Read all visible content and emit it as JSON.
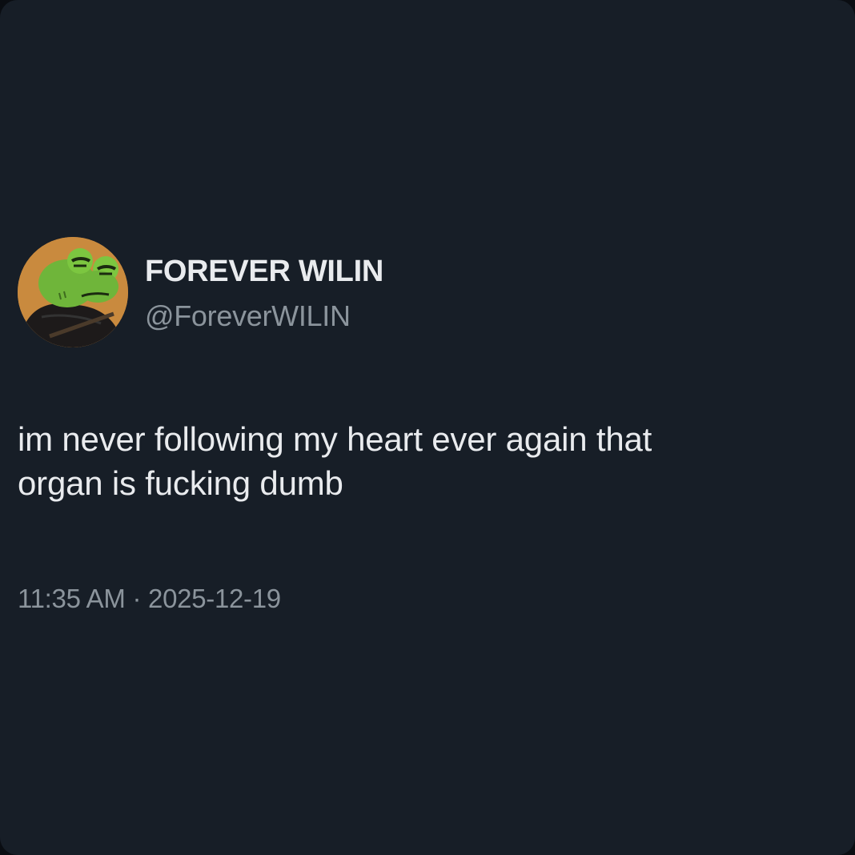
{
  "tweet": {
    "display_name": "FOREVER WILIN",
    "handle": "@ForeverWILIN",
    "text_lines": [
      "im never following my heart ever again that",
      "organ is fucking dumb"
    ],
    "time": "11:35 AM",
    "separator": "·",
    "date": "2025-12-19",
    "avatar": {
      "icon": "cartoon-frog-avatar-icon",
      "background_color": "#c98a3e"
    }
  },
  "theme": {
    "background": "#171e27",
    "primary_text": "#e9ebee",
    "secondary_text": "#8b949c"
  }
}
